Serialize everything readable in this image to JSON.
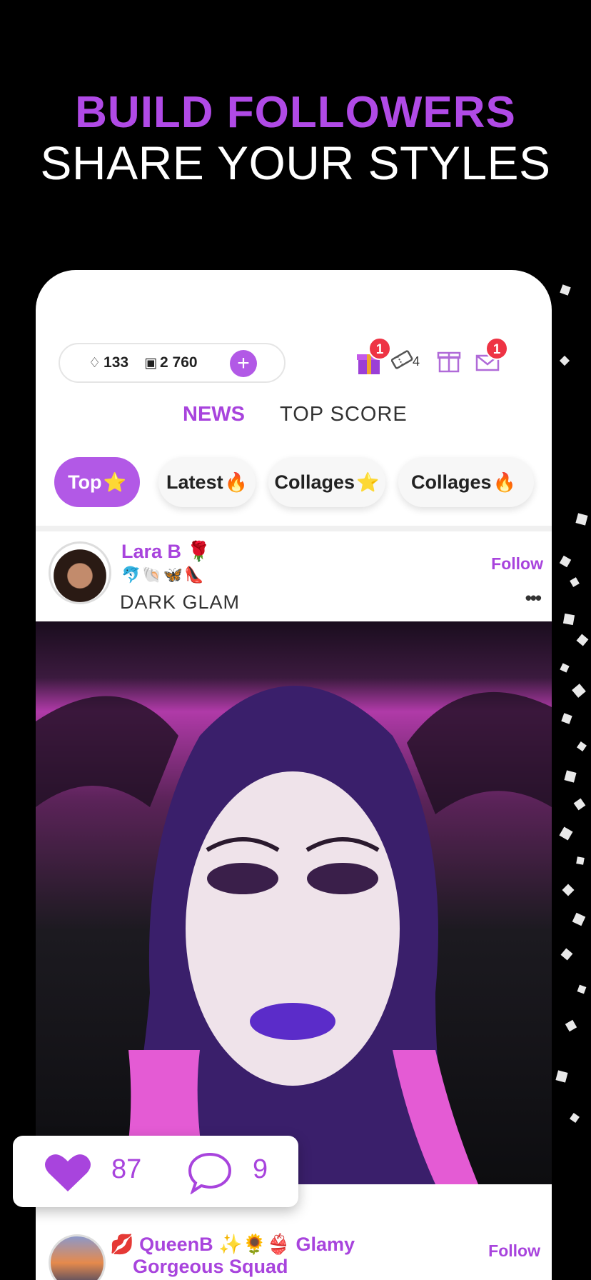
{
  "headline": {
    "line1": "BUILD FOLLOWERS",
    "line2": "SHARE YOUR STYLES"
  },
  "wallet": {
    "diamonds": "133",
    "coins": "2 760",
    "add_label": "+"
  },
  "top_icons": {
    "gift_box_badge": "1",
    "tickets_count": "4",
    "mail_badge": "1"
  },
  "tabs": [
    {
      "label": "NEWS",
      "active": true
    },
    {
      "label": "TOP SCORE",
      "active": false
    }
  ],
  "chips": [
    {
      "label": "Top",
      "emoji": "⭐",
      "active": true
    },
    {
      "label": "Latest",
      "emoji": "🔥",
      "active": false
    },
    {
      "label": "Collages",
      "emoji": "⭐",
      "active": false
    },
    {
      "label": "Collages",
      "emoji": "🔥",
      "active": false
    }
  ],
  "post": {
    "user_name": "Lara B 🌹",
    "user_emojis": "🐬🐚🦋👠",
    "title": "DARK GLAM",
    "follow_label": "Follow",
    "more_label": "•••",
    "likes": "87",
    "comments": "9"
  },
  "post2": {
    "user_name_line1": "💋 QueenB ✨🌻👙 Glamy",
    "user_name_line2": "Gorgeous Squad",
    "follow_label": "Follow"
  },
  "colors": {
    "accent": "#b259e6",
    "accent_text": "#a844dd",
    "badge": "#ee3344"
  }
}
